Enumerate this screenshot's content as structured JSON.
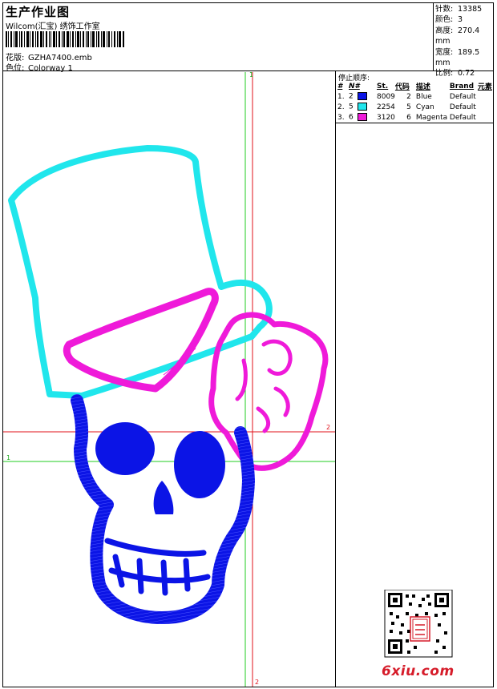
{
  "header": {
    "title": "生产作业图",
    "studio": "Wilcom(汇宝) 绣饰工作室",
    "design_label": "花版:",
    "design_value": "GZHA7400.emb",
    "colorway_label": "色位:",
    "colorway_value": "Colorway 1"
  },
  "stats": {
    "stitches_label": "针数:",
    "stitches": "13385",
    "colors_label": "颜色:",
    "colors": "3",
    "height_label": "高度:",
    "height": "270.4 mm",
    "width_label": "宽度:",
    "width": "189.5 mm",
    "scale_label": "比例:",
    "scale": "0.72"
  },
  "stop_sequence": {
    "title": "停止顺序:",
    "headers": [
      "#",
      "N#",
      "St.",
      "代码",
      "描述",
      "Brand",
      "元素"
    ],
    "rows": [
      {
        "idx": "1.",
        "n": "2",
        "code": "8009",
        "st": "2",
        "desc": "Blue",
        "brand": "Default",
        "color": "#0b14e6"
      },
      {
        "idx": "2.",
        "n": "5",
        "code": "2254",
        "st": "5",
        "desc": "Cyan",
        "brand": "Default",
        "color": "#20e6ec"
      },
      {
        "idx": "3.",
        "n": "6",
        "code": "3120",
        "st": "6",
        "desc": "Magenta",
        "brand": "Default",
        "color": "#ef1ad9"
      }
    ]
  },
  "guides": {
    "green_label_top": "1",
    "green_label_left": "1",
    "red_label_right": "2",
    "red_label_bottom": "2"
  },
  "colors": {
    "blue": "#0b14e6",
    "cyan": "#20e6ec",
    "magenta": "#ef1ad9",
    "guide_red": "#e0101a",
    "guide_green": "#22cc22"
  },
  "watermark": {
    "brand": "6xiu.com"
  }
}
